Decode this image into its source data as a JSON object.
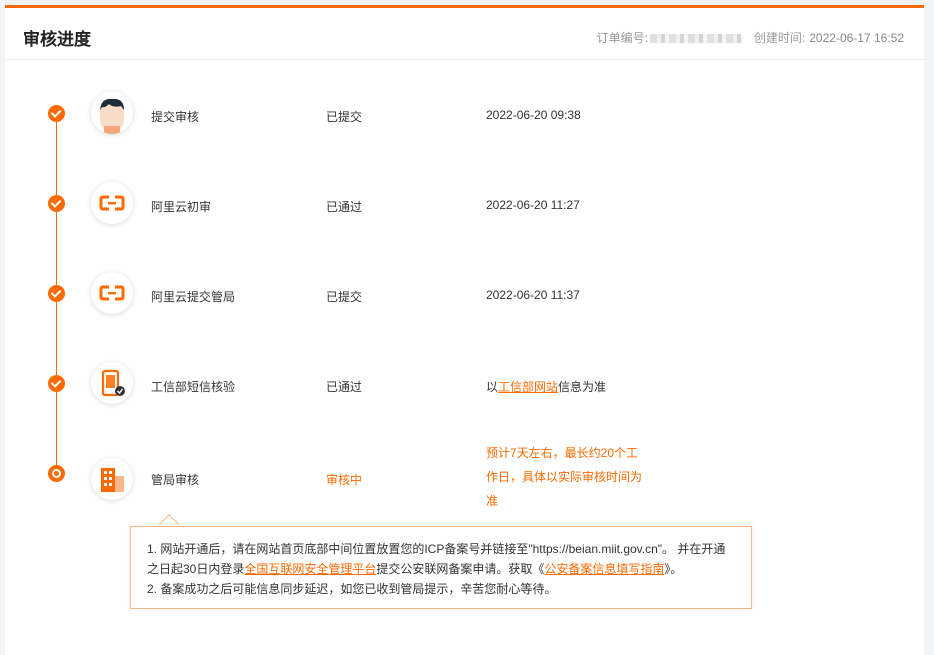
{
  "header": {
    "title": "审核进度",
    "order_label": "订单编号:",
    "created_label": "创建时间:",
    "created_value": "2022-06-17 16:52"
  },
  "steps": [
    {
      "name": "提交审核",
      "status": "已提交",
      "time": "2022-06-20 09:38",
      "icon": "user-avatar-icon",
      "state": "done"
    },
    {
      "name": "阿里云初审",
      "status": "已通过",
      "time": "2022-06-20 11:27",
      "icon": "aliyun-logo-icon",
      "state": "done"
    },
    {
      "name": "阿里云提交管局",
      "status": "已提交",
      "time": "2022-06-20 11:37",
      "icon": "aliyun-logo-icon",
      "state": "done"
    },
    {
      "name": "工信部短信核验",
      "status": "已通过",
      "time_prefix": "以",
      "time_link": "工信部网站",
      "time_suffix": "信息为准",
      "icon": "phone-verify-icon",
      "state": "done"
    },
    {
      "name": "管局审核",
      "status": "审核中",
      "note": "预计7天左右，最长约20个工作日，具体以实际审核时间为准",
      "icon": "building-icon",
      "state": "active"
    }
  ],
  "tip": {
    "line1": "1. 网站开通后，请在网站首页底部中间位置放置您的ICP备案号并链接至\"https://beian.miit.gov.cn\"。 并在开通",
    "line2_prefix": "之日起30日内登录",
    "line2_link1": "全国互联网安全管理平台",
    "line2_middle": "提交公安联网备案申请。获取《",
    "line2_link2": "公安备案信息填写指南",
    "line2_suffix": "》。",
    "line3": "2. 备案成功之后可能信息同步延迟，如您已收到管局提示，辛苦您耐心等待。"
  },
  "colors": {
    "accent": "#ff6a00",
    "border": "#f6b789"
  }
}
